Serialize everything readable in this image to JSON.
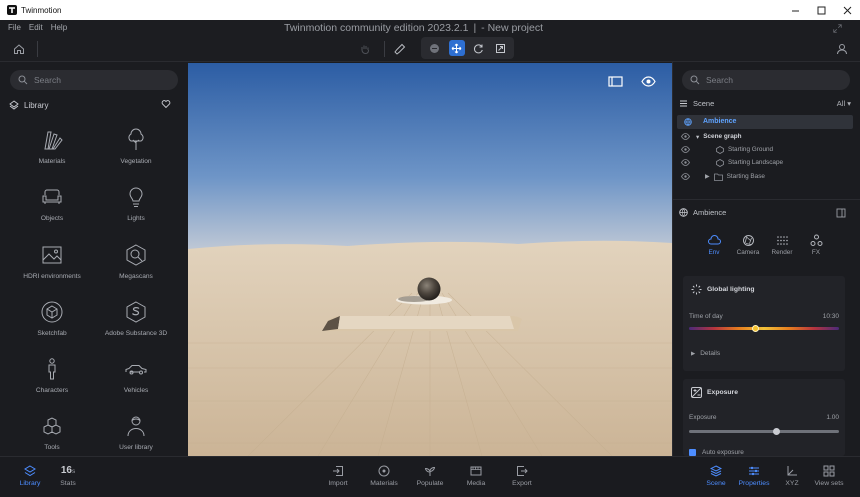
{
  "window": {
    "title": "Twinmotion"
  },
  "menu": [
    "File",
    "Edit",
    "Help"
  ],
  "app": {
    "title": "Twinmotion community edition 2023.2.1",
    "separator": "|",
    "project": "- New project"
  },
  "left": {
    "search_placeholder": "Search",
    "library_label": "Library",
    "items": [
      {
        "label": "Materials",
        "icon": "materials-icon"
      },
      {
        "label": "Vegetation",
        "icon": "tree-icon"
      },
      {
        "label": "Objects",
        "icon": "sofa-icon"
      },
      {
        "label": "Lights",
        "icon": "lightbulb-icon"
      },
      {
        "label": "HDRI environments",
        "icon": "image-icon"
      },
      {
        "label": "Megascans",
        "icon": "megascans-icon"
      },
      {
        "label": "Sketchfab",
        "icon": "sketchfab-icon"
      },
      {
        "label": "Adobe Substance 3D",
        "icon": "substance-icon"
      },
      {
        "label": "Characters",
        "icon": "person-icon"
      },
      {
        "label": "Vehicles",
        "icon": "car-icon"
      },
      {
        "label": "Tools",
        "icon": "cubes-icon"
      },
      {
        "label": "User library",
        "icon": "user-icon"
      }
    ]
  },
  "right": {
    "search_placeholder": "Search",
    "scene_label": "Scene",
    "filter_label": "All",
    "ambience_row": "Ambience",
    "tree": [
      {
        "label": "Scene graph"
      },
      {
        "label": "Starting Ground"
      },
      {
        "label": "Starting Landscape"
      },
      {
        "label": "Starting Base"
      }
    ],
    "properties_title": "Ambience",
    "tabs": [
      {
        "label": "Env",
        "active": true
      },
      {
        "label": "Camera",
        "active": false
      },
      {
        "label": "Render",
        "active": false
      },
      {
        "label": "FX",
        "active": false
      }
    ],
    "global_lighting": {
      "title": "Global lighting",
      "time_label": "Time of day",
      "time_value": "10:30",
      "time_fraction": 0.44,
      "details_label": "Details"
    },
    "exposure": {
      "title": "Exposure",
      "label": "Exposure",
      "value": "1.00",
      "fraction": 0.58,
      "auto_label": "Auto exposure"
    }
  },
  "bottom": {
    "left": [
      {
        "label": "Library",
        "active": true
      },
      {
        "label": "Stats",
        "value": "16",
        "unit": "s"
      }
    ],
    "center": [
      "Import",
      "Materials",
      "Populate",
      "Media",
      "Export"
    ],
    "right": [
      {
        "label": "Scene",
        "active": true
      },
      {
        "label": "Properties",
        "active": true
      },
      {
        "label": "XYZ",
        "active": false
      },
      {
        "label": "View sets",
        "active": false
      }
    ]
  },
  "colors": {
    "accent": "#2e6fd1",
    "active_text": "#4d8dff",
    "background": "#1b1c20",
    "sky_top": "#2d5fa6",
    "ground": "#d7c5ab"
  }
}
